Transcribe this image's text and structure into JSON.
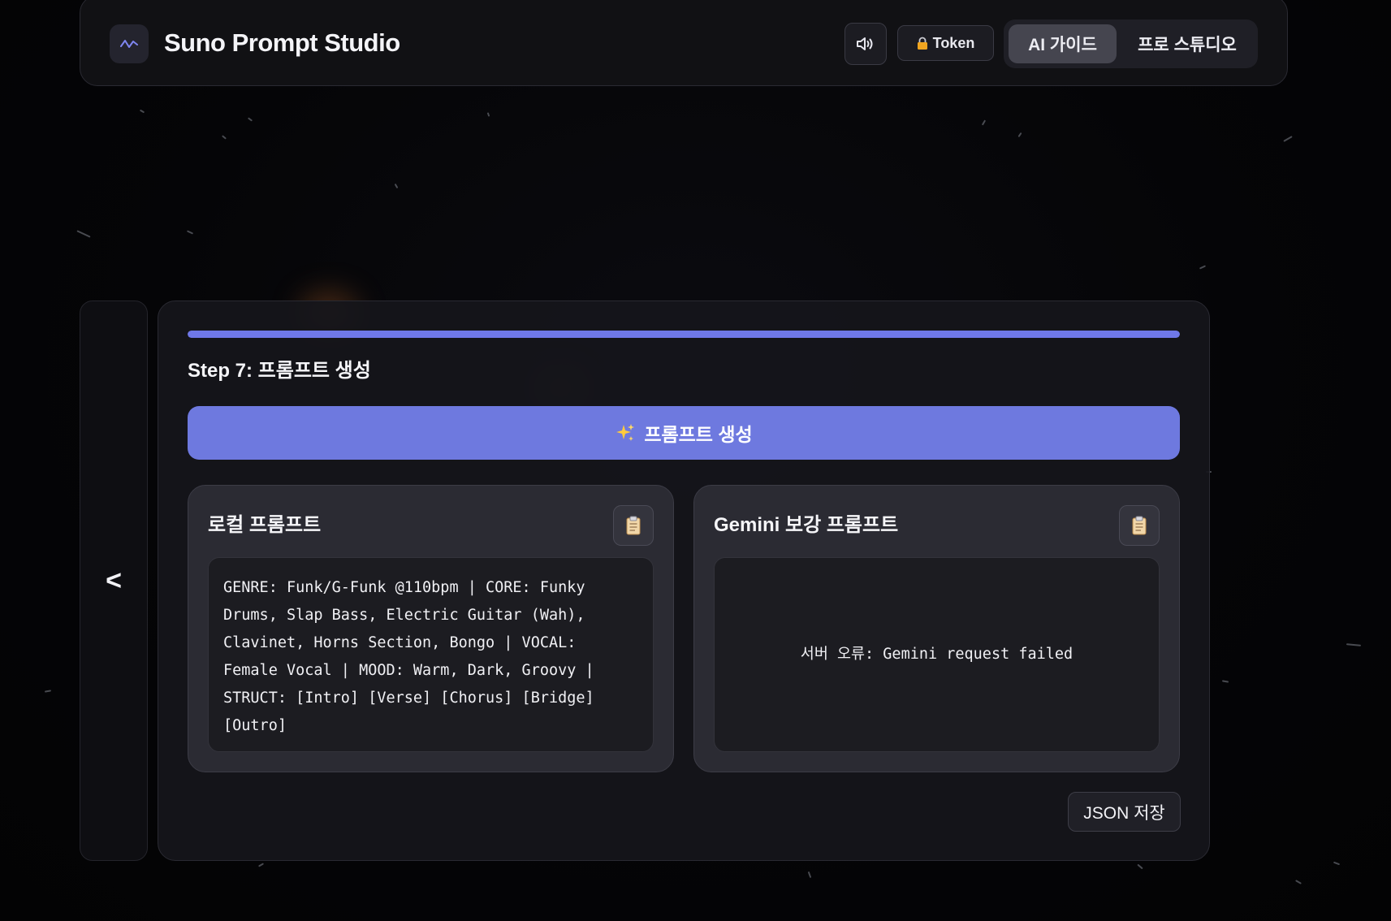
{
  "header": {
    "app_title": "Suno Prompt Studio",
    "token_label": "Token",
    "modes": [
      {
        "label": "AI 가이드",
        "active": true
      },
      {
        "label": "프로 스튜디오",
        "active": false
      }
    ]
  },
  "icons": {
    "logo": "waveform-icon",
    "sound": "speaker-icon",
    "token": "lock-icon",
    "generate": "sparkles-icon",
    "copy": "clipboard-icon"
  },
  "side_nav": {
    "back_label": "<"
  },
  "wizard": {
    "progress": 1.0,
    "step_title": "Step 7: 프롬프트 생성",
    "generate_label": "프롬프트 생성"
  },
  "local_prompt": {
    "title": "로컬 프롬프트",
    "text": "GENRE: Funk/G-Funk @110bpm | CORE: Funky Drums, Slap Bass, Electric Guitar (Wah), Clavinet, Horns Section, Bongo | VOCAL: Female Vocal | MOOD: Warm, Dark, Groovy | STRUCT: [Intro] [Verse] [Chorus] [Bridge] [Outro]"
  },
  "gemini_prompt": {
    "title": "Gemini 보강 프롬프트",
    "text": "서버 오류: Gemini request failed"
  },
  "footer": {
    "save_json_label": "JSON 저장"
  },
  "colors": {
    "accent": "#6e79df",
    "progress": "#6f78e8",
    "background": "#040406"
  }
}
